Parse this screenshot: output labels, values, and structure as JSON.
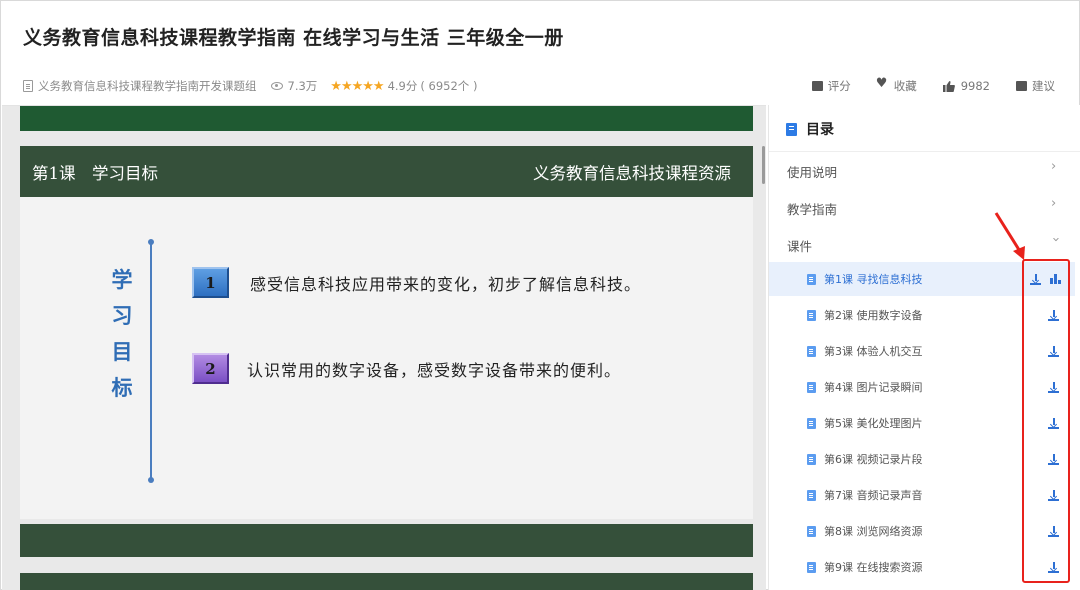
{
  "header": {
    "title": "义务教育信息科技课程教学指南 在线学习与生活 三年级全一册",
    "author": "义务教育信息科技课程教学指南开发课题组",
    "views": "7.3万",
    "stars": "★★★★★",
    "score": "4.9分",
    "rating_count": "( 6952个 )",
    "actions": {
      "rate": "评分",
      "favorite": "收藏",
      "likes": "9982",
      "suggest": "建议"
    }
  },
  "slide": {
    "lesson_label": "第1课　学习目标",
    "resource_label": "义务教育信息科技课程资源",
    "vertical_title": [
      "学",
      "习",
      "目",
      "标"
    ],
    "goals": [
      {
        "num": "1",
        "text": "感受信息科技应用带来的变化，初步了解信息科技。"
      },
      {
        "num": "2",
        "text": "认识常用的数字设备，感受数字设备带来的便利。"
      }
    ]
  },
  "toc": {
    "title": "目录",
    "categories": [
      "使用说明",
      "教学指南",
      "课件"
    ],
    "lessons": [
      "第1课 寻找信息科技",
      "第2课 使用数字设备",
      "第3课 体验人机交互",
      "第4课 图片记录瞬间",
      "第5课 美化处理图片",
      "第6课 视频记录片段",
      "第7课 音频记录声音",
      "第8课 浏览网络资源",
      "第9课 在线搜索资源"
    ],
    "active_lesson": 0
  },
  "colors": {
    "accent": "#2d6fd3",
    "slide_green": "#35503a",
    "highlight_red": "#e8221c",
    "star": "#f5a623"
  }
}
